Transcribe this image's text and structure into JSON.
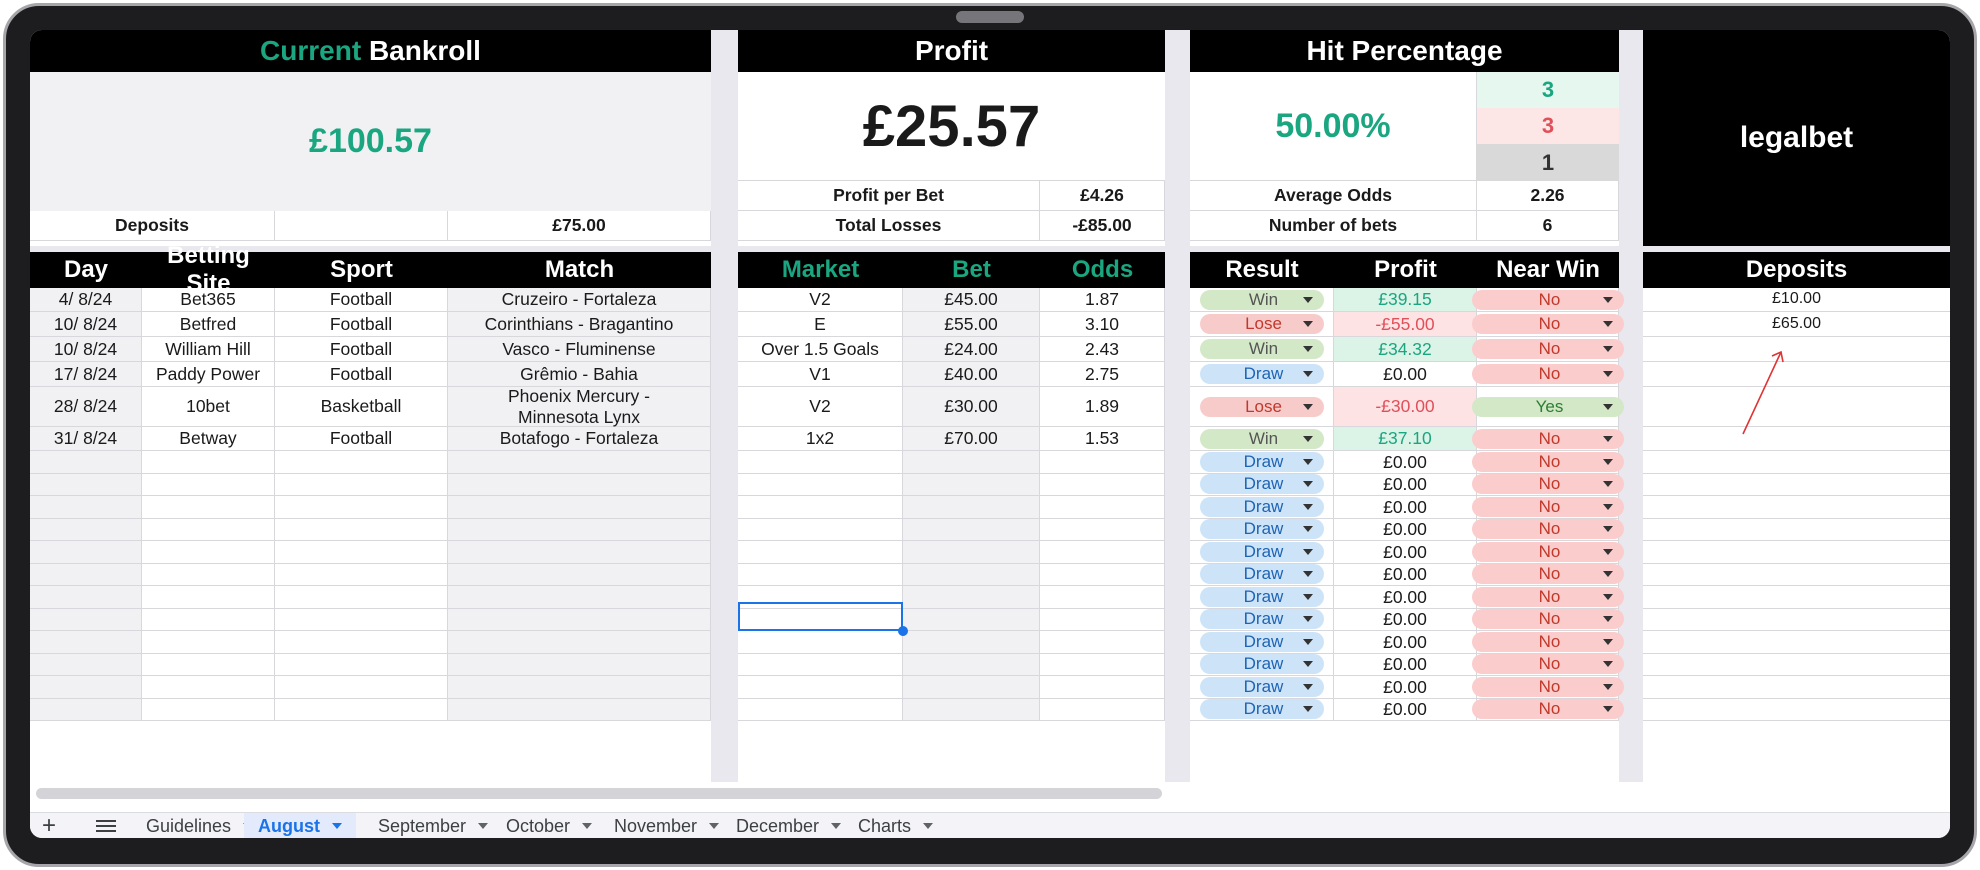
{
  "bankroll": {
    "title_accent": "Current",
    "title_rest": "Bankroll",
    "value": "£100.57",
    "deposits_label": "Deposits",
    "deposits_value": "£75.00"
  },
  "profit": {
    "title": "Profit",
    "value": "£25.57",
    "per_bet_label": "Profit per Bet",
    "per_bet_value": "£4.26",
    "losses_label": "Total Losses",
    "losses_value": "-£85.00"
  },
  "hit": {
    "title": "Hit Percentage",
    "value": "50.00%",
    "wins": "3",
    "losses": "3",
    "draws": "1",
    "avg_odds_label": "Average Odds",
    "avg_odds_value": "2.26",
    "num_bets_label": "Number of bets",
    "num_bets_value": "6"
  },
  "brand": {
    "logo_text": "legalbet"
  },
  "table_headers": {
    "day": "Day",
    "site": "Betting Site",
    "sport": "Sport",
    "match": "Match",
    "market": "Market",
    "bet": "Bet",
    "odds": "Odds",
    "result": "Result",
    "profit": "Profit",
    "near_win": "Near Win",
    "deposits": "Deposits"
  },
  "bets": [
    {
      "day": "4/ 8/24",
      "site": "Bet365",
      "sport": "Football",
      "match": "Cruzeiro - Fortaleza",
      "market": "V2",
      "bet": "£45.00",
      "odds": "1.87",
      "result": "Win",
      "profit": "£39.15",
      "near_win": "No"
    },
    {
      "day": "10/ 8/24",
      "site": "Betfred",
      "sport": "Football",
      "match": "Corinthians - Bragantino",
      "market": "E",
      "bet": "£55.00",
      "odds": "3.10",
      "result": "Lose",
      "profit": "-£55.00",
      "near_win": "No"
    },
    {
      "day": "10/ 8/24",
      "site": "William Hill",
      "sport": "Football",
      "match": "Vasco - Fluminense",
      "market": "Over 1.5 Goals",
      "bet": "£24.00",
      "odds": "2.43",
      "result": "Win",
      "profit": "£34.32",
      "near_win": "No"
    },
    {
      "day": "17/ 8/24",
      "site": "Paddy Power",
      "sport": "Football",
      "match": "Grêmio - Bahia",
      "market": "V1",
      "bet": "£40.00",
      "odds": "2.75",
      "result": "Draw",
      "profit": "£0.00",
      "near_win": "No"
    },
    {
      "day": "28/ 8/24",
      "site": "10bet",
      "sport": "Basketball",
      "match_line1": "Phoenix Mercury -",
      "match_line2": "Minnesota Lynx",
      "market": "V2",
      "bet": "£30.00",
      "odds": "1.89",
      "result": "Lose",
      "profit": "-£30.00",
      "near_win": "Yes"
    },
    {
      "day": "31/ 8/24",
      "site": "Betway",
      "sport": "Football",
      "match": "Botafogo - Fortaleza",
      "market": "1x2",
      "bet": "£70.00",
      "odds": "1.53",
      "result": "Win",
      "profit": "£37.10",
      "near_win": "No"
    }
  ],
  "empty_rows": {
    "result": "Draw",
    "profit": "£0.00",
    "near_win": "No"
  },
  "deposits_list": [
    "£10.00",
    "£65.00"
  ],
  "tabs": [
    "Guidelines",
    "August",
    "September",
    "October",
    "November",
    "December",
    "Charts"
  ],
  "active_tab": "August",
  "colors": {
    "accent_green": "#1aa680",
    "loss_red": "#e0505b",
    "header_black": "#000000",
    "selection_blue": "#1a73e8"
  }
}
